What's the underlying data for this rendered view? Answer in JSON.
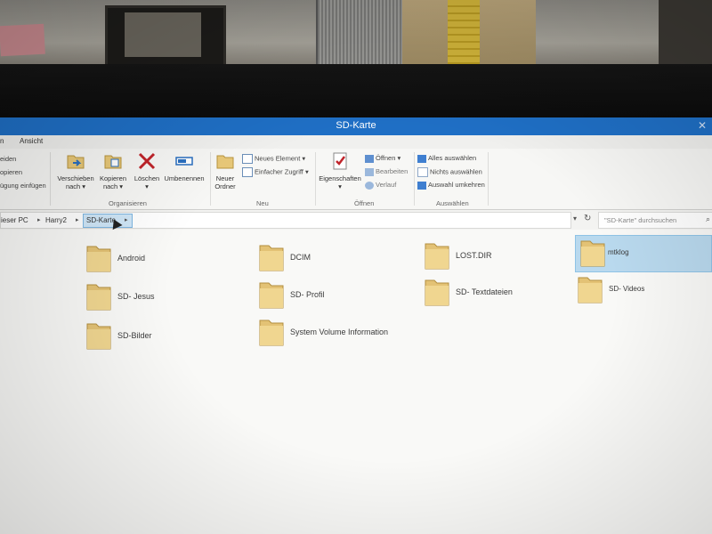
{
  "window": {
    "title": "SD-Karte"
  },
  "menu": {
    "partial_left": "n",
    "ansicht": "Ansicht"
  },
  "ribbon": {
    "clipboard_partial": [
      "eiden",
      "opieren",
      "ügung einfügen"
    ],
    "verschieben": [
      "Verschieben",
      "nach"
    ],
    "kopieren": [
      "Kopieren",
      "nach"
    ],
    "loeschen": "Löschen",
    "umbenennen": "Umbenennen",
    "group_organisieren": "Organisieren",
    "neuer_ordner": [
      "Neuer",
      "Ordner"
    ],
    "neues_element": "Neues Element",
    "einfacher_zugriff": "Einfacher Zugriff",
    "group_neu": "Neu",
    "eigenschaften": "Eigenschaften",
    "oeffnen": "Öffnen",
    "bearbeiten": "Bearbeiten",
    "verlauf": "Verlauf",
    "group_oeffnen": "Öffnen",
    "alles_auswaehlen": "Alles auswählen",
    "nichts_auswaehlen": "Nichts auswählen",
    "auswahl_umkehren": "Auswahl umkehren",
    "group_auswaehlen": "Auswählen"
  },
  "address": {
    "crumbs": [
      "ieser PC",
      "Harry2",
      "SD-Karte"
    ],
    "search_placeholder": "\"SD-Karte\" durchsuchen"
  },
  "items": [
    {
      "label": "Android",
      "selected": false
    },
    {
      "label": "DCIM",
      "selected": false
    },
    {
      "label": "LOST.DIR",
      "selected": false
    },
    {
      "label": "mtklog",
      "selected": true
    },
    {
      "label": "SD- Jesus",
      "selected": false
    },
    {
      "label": "SD- Profil",
      "selected": false
    },
    {
      "label": "SD- Textdateien",
      "selected": false
    },
    {
      "label": "SD- Videos",
      "selected": false
    },
    {
      "label": "SD-Bilder",
      "selected": false
    },
    {
      "label": "System Volume Information",
      "selected": false
    }
  ],
  "colors": {
    "titlebar": "#1f6fc5",
    "selection": "#b9d9ee",
    "folder": "#e8c878"
  }
}
